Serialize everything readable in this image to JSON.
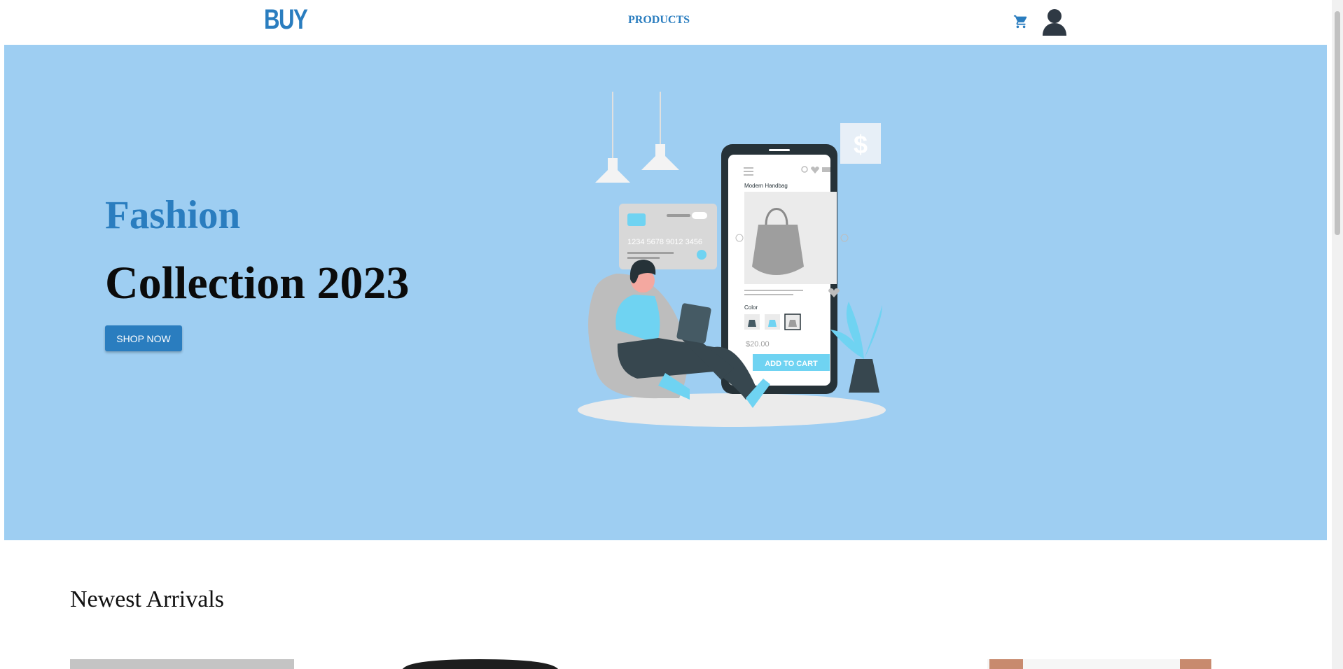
{
  "navbar": {
    "logo": "BUY",
    "products_link": "PRODUCTS",
    "cart_icon": "shopping-cart-icon",
    "user_icon": "user-avatar-icon"
  },
  "hero": {
    "subtitle": "Fashion",
    "title": "Collection 2023",
    "cta_label": "SHOP NOW",
    "illustration": {
      "card_number": "1234 5678 9012 3456",
      "product_name": "Modern Handbag",
      "color_label": "Color",
      "price": "$20.00",
      "add_to_cart": "ADD TO CART",
      "dollar_sign": "$"
    }
  },
  "newest": {
    "title": "Newest Arrivals"
  },
  "colors": {
    "brand": "#2a7dbf",
    "hero_bg": "#9ecef2",
    "dark": "#0b0b0b"
  }
}
